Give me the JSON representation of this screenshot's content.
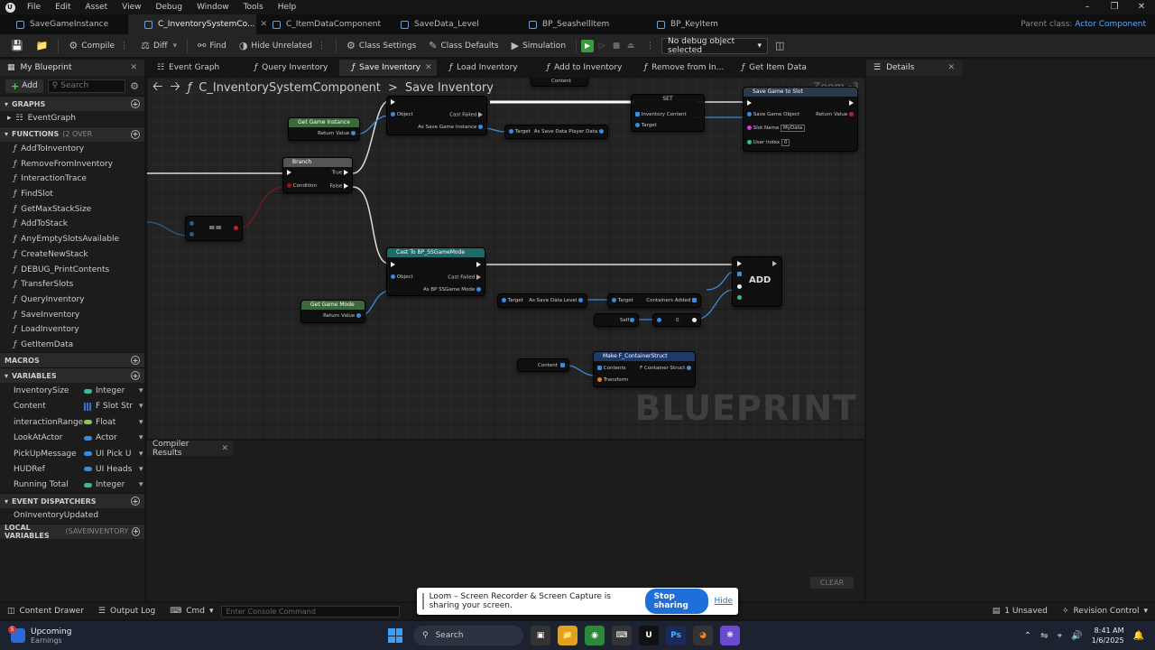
{
  "menu": [
    "File",
    "Edit",
    "Asset",
    "View",
    "Debug",
    "Window",
    "Tools",
    "Help"
  ],
  "doc_tabs": [
    {
      "label": "SaveGameInstance",
      "active": false
    },
    {
      "label": "C_InventorySystemCo...",
      "active": true
    },
    {
      "label": "C_ItemDataComponent",
      "active": false
    },
    {
      "label": "SaveData_Level",
      "active": false
    },
    {
      "label": "BP_SeashellItem",
      "active": false
    },
    {
      "label": "BP_KeyItem",
      "active": false
    }
  ],
  "parent_class": {
    "label": "Parent class:",
    "value": "Actor Component"
  },
  "toolbar": {
    "compile": "Compile",
    "diff": "Diff",
    "find": "Find",
    "hide_unrelated": "Hide Unrelated",
    "class_settings": "Class Settings",
    "class_defaults": "Class Defaults",
    "simulation": "Simulation",
    "debug_object": "No debug object selected"
  },
  "my_blueprint": {
    "tab": "My Blueprint",
    "add": "Add",
    "search_placeholder": "Search"
  },
  "sections": {
    "graphs": "GRAPHS",
    "functions": "FUNCTIONS",
    "functions_count": "(2 OVER",
    "macros": "MACROS",
    "variables": "VARIABLES",
    "event_dispatchers": "EVENT DISPATCHERS",
    "local_variables": "LOCAL VARIABLES",
    "local_variables_ctx": "(SAVEINVENTORY"
  },
  "graphs": [
    "EventGraph"
  ],
  "functions": [
    "AddToInventory",
    "RemoveFromInventory",
    "InteractionTrace",
    "FindSlot",
    "GetMaxStackSize",
    "AddToStack",
    "AnyEmptySlotsAvailable",
    "CreateNewStack",
    "DEBUG_PrintContents",
    "TransferSlots",
    "QueryInventory",
    "SaveInventory",
    "LoadInventory",
    "GetItemData"
  ],
  "variables": [
    {
      "name": "InventorySize",
      "type": "Integer",
      "color": "#2fbf9a"
    },
    {
      "name": "Content",
      "type": "F Slot Str",
      "color": "#3a6cd0",
      "array": true
    },
    {
      "name": "interactionRange",
      "type": "Float",
      "color": "#7ad04a"
    },
    {
      "name": "LookAtActor",
      "type": "Actor",
      "color": "#2f8fe0"
    },
    {
      "name": "PickUpMessage",
      "type": "UI Pick U",
      "color": "#2f8fe0"
    },
    {
      "name": "HUDRef",
      "type": "UI Heads",
      "color": "#2f8fe0"
    },
    {
      "name": "Running Total",
      "type": "Integer",
      "color": "#2fbf9a"
    }
  ],
  "event_dispatchers": [
    "OnInventoryUpdated"
  ],
  "graph_tabs": [
    {
      "label": "Event Graph",
      "active": false,
      "fn": false
    },
    {
      "label": "Query Inventory",
      "active": false,
      "fn": true
    },
    {
      "label": "Save Inventory",
      "active": true,
      "fn": true
    },
    {
      "label": "Load Inventory",
      "active": false,
      "fn": true
    },
    {
      "label": "Add to Inventory",
      "active": false,
      "fn": true
    },
    {
      "label": "Remove from In...",
      "active": false,
      "fn": true
    },
    {
      "label": "Get Item Data",
      "active": false,
      "fn": true
    }
  ],
  "breadcrumb": {
    "root": "C_InventorySystemComponent",
    "separator": ">",
    "current": "Save Inventory"
  },
  "zoom": "Zoom -3",
  "watermark": "BLUEPRINT",
  "nodes": {
    "get_game_instance": {
      "title": "Get Game Instance",
      "pin": "Return Value"
    },
    "cast_top": {
      "object": "Object",
      "cast_failed": "Cast Failed",
      "out": "As Save Game Instance"
    },
    "content_top": "Content",
    "save_data_target": {
      "target": "Target",
      "out": "As Save Data Player Data"
    },
    "set_node": {
      "title": "SET",
      "pin1": "Inventory Content",
      "pin2": "Target"
    },
    "save_game": {
      "title": "Save Game to Slot",
      "pin1": "Save Game Object",
      "ret": "Return Value",
      "slot_label": "Slot Name",
      "slot_value": "MyData",
      "user_label": "User Index",
      "user_value": "0"
    },
    "branch": {
      "title": "Branch",
      "true_pin": "True",
      "condition": "Condition",
      "false_pin": "False"
    },
    "equals": "==",
    "cast_mode": {
      "title": "Cast To BP_SSGameMode",
      "object": "Object",
      "cast_failed": "Cast Failed",
      "out": "As BP SSGame Mode"
    },
    "get_game_mode": {
      "title": "Get Game Mode",
      "pin": "Return Value"
    },
    "target_level": {
      "target": "Target",
      "out": "As Save Data Level"
    },
    "target_containers": {
      "target": "Target",
      "out": "Containers Added"
    },
    "self": "Self",
    "zero": "0",
    "add": "ADD",
    "content_var": "Content",
    "make_struct": {
      "title": "Make F_ContainerStruct",
      "contents": "Contents",
      "out": "F Container Struct",
      "transform": "Transform"
    }
  },
  "compiler": {
    "tab": "Compiler Results",
    "clear": "CLEAR"
  },
  "details": {
    "tab": "Details"
  },
  "statusbar": {
    "content_drawer": "Content Drawer",
    "output_log": "Output Log",
    "cmd": "Cmd",
    "console_placeholder": "Enter Console Command",
    "unsaved": "1 Unsaved",
    "revision": "Revision Control"
  },
  "loom": {
    "message": "Loom – Screen Recorder & Screen Capture is sharing your screen.",
    "stop": "Stop sharing",
    "hide": "Hide"
  },
  "taskbar": {
    "weather_title": "Upcoming",
    "weather_sub": "Earnings",
    "badge": "5",
    "search": "Search",
    "time": "8:41 AM",
    "date": "1/6/2025"
  }
}
